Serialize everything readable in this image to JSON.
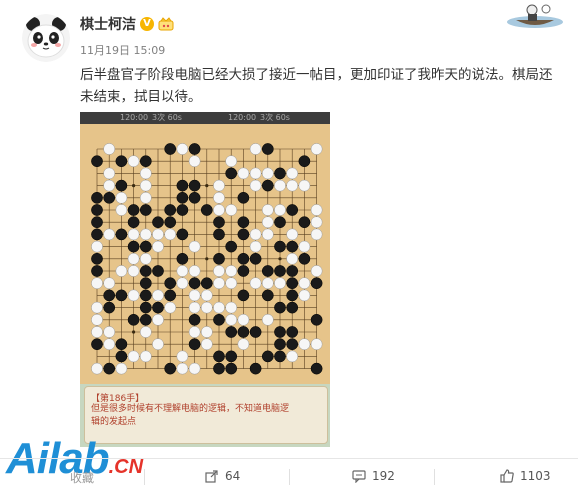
{
  "user": {
    "name": "棋士柯洁",
    "verified_badge": "V",
    "timestamp": "11月19日 15:09",
    "verified_color": "#f7b500"
  },
  "post": {
    "text": "后半盘官子阶段电脑已经大损了接近一帖目，更加印证了我昨天的说法。棋局还未结束，拭目以待。",
    "image": {
      "timer_left": "120:00",
      "timer_left_extra": "3次 60s",
      "timer_right": "120:00",
      "timer_right_extra": "3次 60s",
      "move_label": "【第186手】",
      "caption": "但是很多时候有不理解电脑的逻辑，不知道电脑逻辑的发起点"
    }
  },
  "watermark": {
    "main": "Ailab",
    "suffix": ".CN",
    "partial_label": "收藏"
  },
  "actions": {
    "share_count": "64",
    "comment_count": "192",
    "like_count": "1103"
  },
  "icons": [
    "avatar-panda",
    "verified-icon",
    "crown-icon",
    "share-icon",
    "comment-icon",
    "like-icon"
  ]
}
